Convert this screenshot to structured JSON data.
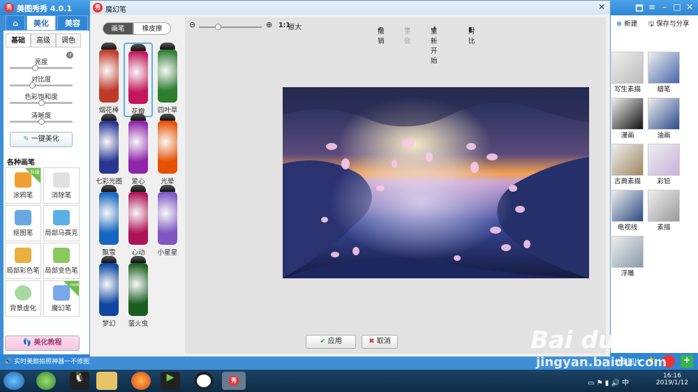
{
  "app": {
    "title": "美图秀秀 4.0.1",
    "logo": "秀"
  },
  "main_tabs": [
    {
      "label": "美化"
    },
    {
      "label": "美容"
    }
  ],
  "sub_tabs": [
    {
      "label": "基础"
    },
    {
      "label": "高级"
    },
    {
      "label": "调色"
    }
  ],
  "sliders": [
    {
      "label": "亮度",
      "level": 0.4
    },
    {
      "label": "对比度",
      "level": 0.35
    },
    {
      "label": "色彩饱和度",
      "level": 0.5
    },
    {
      "label": "清晰度",
      "level": 0.5
    }
  ],
  "one_click": "一键美化",
  "brushes_heading": "各种画笔",
  "tools": [
    {
      "label": "涂鸦笔",
      "badge": "升级"
    },
    {
      "label": "消除笔"
    },
    {
      "label": "抠图笔"
    },
    {
      "label": "局部马赛克"
    },
    {
      "label": "局部彩色笔"
    },
    {
      "label": "局部变色笔"
    },
    {
      "label": "背景虚化"
    },
    {
      "label": "魔幻笔",
      "badge": "new"
    }
  ],
  "tutorial": "美化教程",
  "status": "实时美颜拍照神器一不修图",
  "dialog": {
    "title": "魔幻笔",
    "tabs": [
      {
        "label": "画笔"
      },
      {
        "label": "橡皮擦"
      }
    ],
    "pens": [
      {
        "label": "烟花棒",
        "color": "#c0392b"
      },
      {
        "label": "花瓣",
        "color": "#c2185b"
      },
      {
        "label": "四叶草",
        "color": "#2e7d32"
      },
      {
        "label": "七彩光圈",
        "color": "#283593"
      },
      {
        "label": "爱心",
        "color": "#8e24aa"
      },
      {
        "label": "光晕",
        "color": "#e65100"
      },
      {
        "label": "飘雪",
        "color": "#1565c0"
      },
      {
        "label": "心动",
        "color": "#ad1457"
      },
      {
        "label": "小星星",
        "color": "#7e57c2"
      },
      {
        "label": "梦幻",
        "color": "#0d47a1"
      },
      {
        "label": "萤火虫",
        "color": "#1b5e20"
      }
    ],
    "selected_pen": "花瓣",
    "zoom_ratio": "1:1",
    "zoom_label": "原大",
    "zoom_level": 0.3,
    "undo": "撤销",
    "redo": "重做",
    "restart": "重新开始",
    "compare": "对比",
    "apply": "应用",
    "cancel": "取消"
  },
  "right_panel": {
    "new": "新建",
    "save_share": "保存与分享",
    "effects": [
      {
        "label": "写生素描",
        "color": "#bbb"
      },
      {
        "label": "蜡笔",
        "color": "#4466aa"
      },
      {
        "label": "漫画",
        "color": "#111"
      },
      {
        "label": "油画",
        "color": "#2a4a8a"
      },
      {
        "label": "古典素描",
        "color": "#a08860"
      },
      {
        "label": "彩铅",
        "color": "#c9b0dd"
      },
      {
        "label": "电视线",
        "color": "#2a4a80"
      },
      {
        "label": "素描",
        "color": "#999"
      },
      {
        "label": "浮雕",
        "color": "#8899aa"
      }
    ],
    "share_photo": "分享图片"
  },
  "taskbar": {
    "time": "16:16",
    "date": "2019/1/12"
  },
  "watermark": {
    "brand": "Bai du 经验",
    "url": "jingyan.baidu.com"
  }
}
